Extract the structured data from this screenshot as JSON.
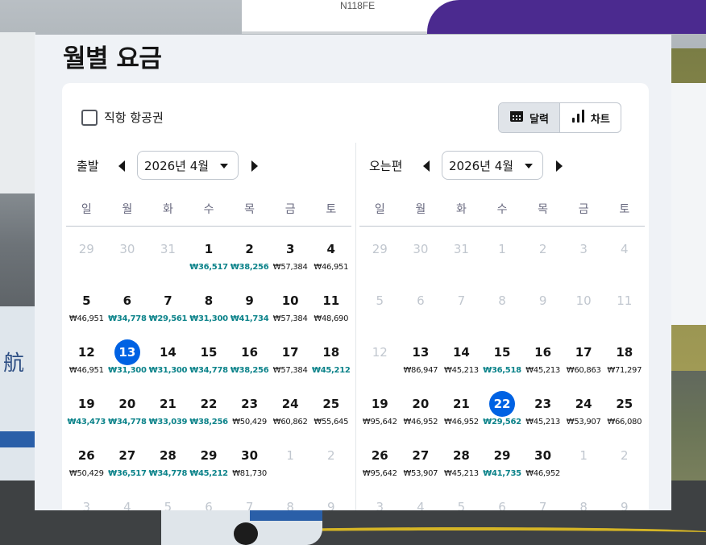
{
  "background": {
    "aircraft_tag": "N118FE",
    "tail_text": "航"
  },
  "page_title": "월별 요금",
  "direct_flights_label": "직항 항공권",
  "view_toggle": {
    "calendar_label": "달력",
    "chart_label": "차트",
    "active": "calendar"
  },
  "colors": {
    "accent": "#0062e3",
    "low_price": "#0c838a",
    "muted": "#c1c7cf"
  },
  "weekdays": [
    "일",
    "월",
    "화",
    "수",
    "목",
    "금",
    "토"
  ],
  "outbound": {
    "label": "출발",
    "month": "2026년 4월",
    "weeks": [
      [
        {
          "d": "29",
          "m": true
        },
        {
          "d": "30",
          "m": true
        },
        {
          "d": "31",
          "m": true
        },
        {
          "d": "1",
          "p": "₩36,517",
          "l": true
        },
        {
          "d": "2",
          "p": "₩38,256",
          "l": true
        },
        {
          "d": "3",
          "p": "₩57,384"
        },
        {
          "d": "4",
          "p": "₩46,951"
        }
      ],
      [
        {
          "d": "5",
          "p": "₩46,951"
        },
        {
          "d": "6",
          "p": "₩34,778",
          "l": true
        },
        {
          "d": "7",
          "p": "₩29,561",
          "l": true
        },
        {
          "d": "8",
          "p": "₩31,300",
          "l": true
        },
        {
          "d": "9",
          "p": "₩41,734",
          "l": true
        },
        {
          "d": "10",
          "p": "₩57,384"
        },
        {
          "d": "11",
          "p": "₩48,690"
        }
      ],
      [
        {
          "d": "12",
          "p": "₩46,951"
        },
        {
          "d": "13",
          "p": "₩31,300",
          "l": true,
          "s": true
        },
        {
          "d": "14",
          "p": "₩31,300",
          "l": true
        },
        {
          "d": "15",
          "p": "₩34,778",
          "l": true
        },
        {
          "d": "16",
          "p": "₩38,256",
          "l": true
        },
        {
          "d": "17",
          "p": "₩57,384"
        },
        {
          "d": "18",
          "p": "₩45,212",
          "l": true
        }
      ],
      [
        {
          "d": "19",
          "p": "₩43,473",
          "l": true
        },
        {
          "d": "20",
          "p": "₩34,778",
          "l": true
        },
        {
          "d": "21",
          "p": "₩33,039",
          "l": true
        },
        {
          "d": "22",
          "p": "₩38,256",
          "l": true
        },
        {
          "d": "23",
          "p": "₩50,429"
        },
        {
          "d": "24",
          "p": "₩60,862"
        },
        {
          "d": "25",
          "p": "₩55,645"
        }
      ],
      [
        {
          "d": "26",
          "p": "₩50,429"
        },
        {
          "d": "27",
          "p": "₩36,517",
          "l": true
        },
        {
          "d": "28",
          "p": "₩34,778",
          "l": true
        },
        {
          "d": "29",
          "p": "₩45,212",
          "l": true
        },
        {
          "d": "30",
          "p": "₩81,730"
        },
        {
          "d": "1",
          "m": true
        },
        {
          "d": "2",
          "m": true
        }
      ],
      [
        {
          "d": "3",
          "m": true
        },
        {
          "d": "4",
          "m": true
        },
        {
          "d": "5",
          "m": true
        },
        {
          "d": "6",
          "m": true
        },
        {
          "d": "7",
          "m": true
        },
        {
          "d": "8",
          "m": true
        },
        {
          "d": "9",
          "m": true
        }
      ]
    ]
  },
  "return": {
    "label": "오는편",
    "month": "2026년 4월",
    "weeks": [
      [
        {
          "d": "29",
          "m": true
        },
        {
          "d": "30",
          "m": true
        },
        {
          "d": "31",
          "m": true
        },
        {
          "d": "1",
          "m": true
        },
        {
          "d": "2",
          "m": true
        },
        {
          "d": "3",
          "m": true
        },
        {
          "d": "4",
          "m": true
        }
      ],
      [
        {
          "d": "5",
          "m": true
        },
        {
          "d": "6",
          "m": true
        },
        {
          "d": "7",
          "m": true
        },
        {
          "d": "8",
          "m": true
        },
        {
          "d": "9",
          "m": true
        },
        {
          "d": "10",
          "m": true
        },
        {
          "d": "11",
          "m": true
        }
      ],
      [
        {
          "d": "12",
          "m": true
        },
        {
          "d": "13",
          "p": "₩86,947"
        },
        {
          "d": "14",
          "p": "₩45,213"
        },
        {
          "d": "15",
          "p": "₩36,518",
          "l": true
        },
        {
          "d": "16",
          "p": "₩45,213"
        },
        {
          "d": "17",
          "p": "₩60,863"
        },
        {
          "d": "18",
          "p": "₩71,297"
        }
      ],
      [
        {
          "d": "19",
          "p": "₩95,642"
        },
        {
          "d": "20",
          "p": "₩46,952"
        },
        {
          "d": "21",
          "p": "₩46,952"
        },
        {
          "d": "22",
          "p": "₩29,562",
          "l": true,
          "s": true
        },
        {
          "d": "23",
          "p": "₩45,213"
        },
        {
          "d": "24",
          "p": "₩53,907"
        },
        {
          "d": "25",
          "p": "₩66,080"
        }
      ],
      [
        {
          "d": "26",
          "p": "₩95,642"
        },
        {
          "d": "27",
          "p": "₩53,907"
        },
        {
          "d": "28",
          "p": "₩45,213"
        },
        {
          "d": "29",
          "p": "₩41,735",
          "l": true
        },
        {
          "d": "30",
          "p": "₩46,952"
        },
        {
          "d": "1",
          "m": true
        },
        {
          "d": "2",
          "m": true
        }
      ],
      [
        {
          "d": "3",
          "m": true
        },
        {
          "d": "4",
          "m": true
        },
        {
          "d": "5",
          "m": true
        },
        {
          "d": "6",
          "m": true
        },
        {
          "d": "7",
          "m": true
        },
        {
          "d": "8",
          "m": true
        },
        {
          "d": "9",
          "m": true
        }
      ]
    ]
  }
}
